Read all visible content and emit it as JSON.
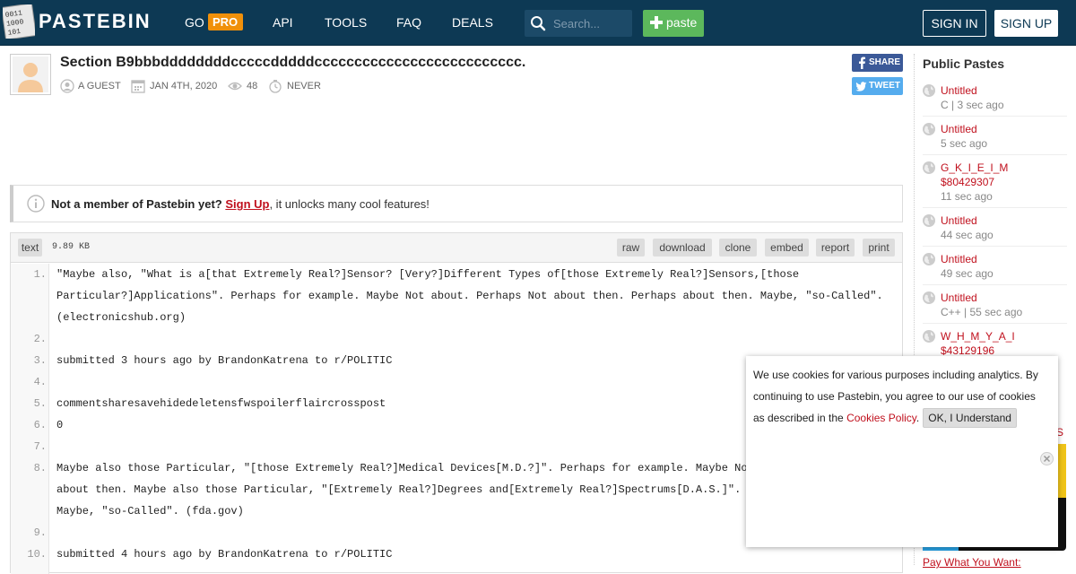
{
  "header": {
    "logo_text": "PASTEBIN",
    "logo_binary": [
      "0011",
      "1000",
      "101"
    ],
    "nav": {
      "go": "GO",
      "pro": "PRO",
      "api": "API",
      "tools": "TOOLS",
      "faq": "FAQ",
      "deals": "DEALS"
    },
    "search_placeholder": "Search...",
    "paste_label": "paste",
    "sign_in": "SIGN IN",
    "sign_up": "SIGN UP"
  },
  "paste": {
    "title": "Section B9bbbddddddddcccccdddddcccccccccccccccccccccccccc.",
    "author": "A GUEST",
    "date": "JAN 4TH, 2020",
    "views": "48",
    "expires": "NEVER",
    "share_label": "SHARE",
    "tweet_label": "TWEET"
  },
  "notice": {
    "prefix": "Not a member of Pastebin yet?",
    "link": "Sign Up",
    "suffix": ", it unlocks many cool features!"
  },
  "code_toolbar": {
    "syntax": "text",
    "size": "9.89 KB",
    "buttons": [
      "raw",
      "download",
      "clone",
      "embed",
      "report",
      "print"
    ]
  },
  "code": {
    "line_numbers": [
      "1.",
      "2.",
      "3.",
      "4.",
      "5.",
      "6.",
      "7.",
      "8.",
      "9.",
      "10."
    ],
    "lines": [
      "\"Maybe also, \"What is a[that Extremely Real?]Sensor? [Very?]Different Types of[those Extremely Real?]Sensors,[those",
      "Particular?]Applications\". Perhaps for example. Maybe Not about. Perhaps Not about then. Perhaps about then. Maybe, \"so-Called\".",
      "(electronicshub.org)",
      "",
      "submitted 3 hours ago by BrandonKatrena to r/POLITIC",
      "",
      "commentsharesavehidedeletensfwspoilerflaircrosspost",
      "0",
      "",
      "Maybe also those Particular, \"[those Extremely Real?]Medical Devices[M.D.?]\". Perhaps for example. Maybe Not a",
      "about then. Maybe also those Particular, \"[Extremely Real?]Degrees and[Extremely Real?]Spectrums[D.A.S.]\". Per",
      "Maybe, \"so-Called\". (fda.gov)",
      "",
      "submitted 4 hours ago by BrandonKatrena to r/POLITIC"
    ]
  },
  "sidebar": {
    "title": "Public Pastes",
    "items": [
      {
        "title": "Untitled",
        "sub": "C | 3 sec ago"
      },
      {
        "title": "Untitled",
        "sub": "5 sec ago"
      },
      {
        "title": "G_K_I_E_I_M",
        "title2": "$80429307",
        "sub": "11 sec ago"
      },
      {
        "title": "Untitled",
        "sub": "44 sec ago"
      },
      {
        "title": "Untitled",
        "sub": "49 sec ago"
      },
      {
        "title": "Untitled",
        "sub": "C++ | 55 sec ago"
      },
      {
        "title": "W_H_M_Y_A_I",
        "title2": "$43129196",
        "sub": ""
      }
    ],
    "peek_text": "S",
    "pay_link": "Pay What You Want:"
  },
  "cookie": {
    "text": "We use cookies for various purposes including analytics. By continuing to use Pastebin, you agree to our use of cookies as described in the",
    "link": "Cookies Policy",
    "period": ".",
    "ok": "OK, I Understand"
  },
  "colors": {
    "header_bg": "#0d3954",
    "accent_red": "#c0101d",
    "pro_orange": "#f0900a",
    "paste_green": "#5cb85c"
  }
}
